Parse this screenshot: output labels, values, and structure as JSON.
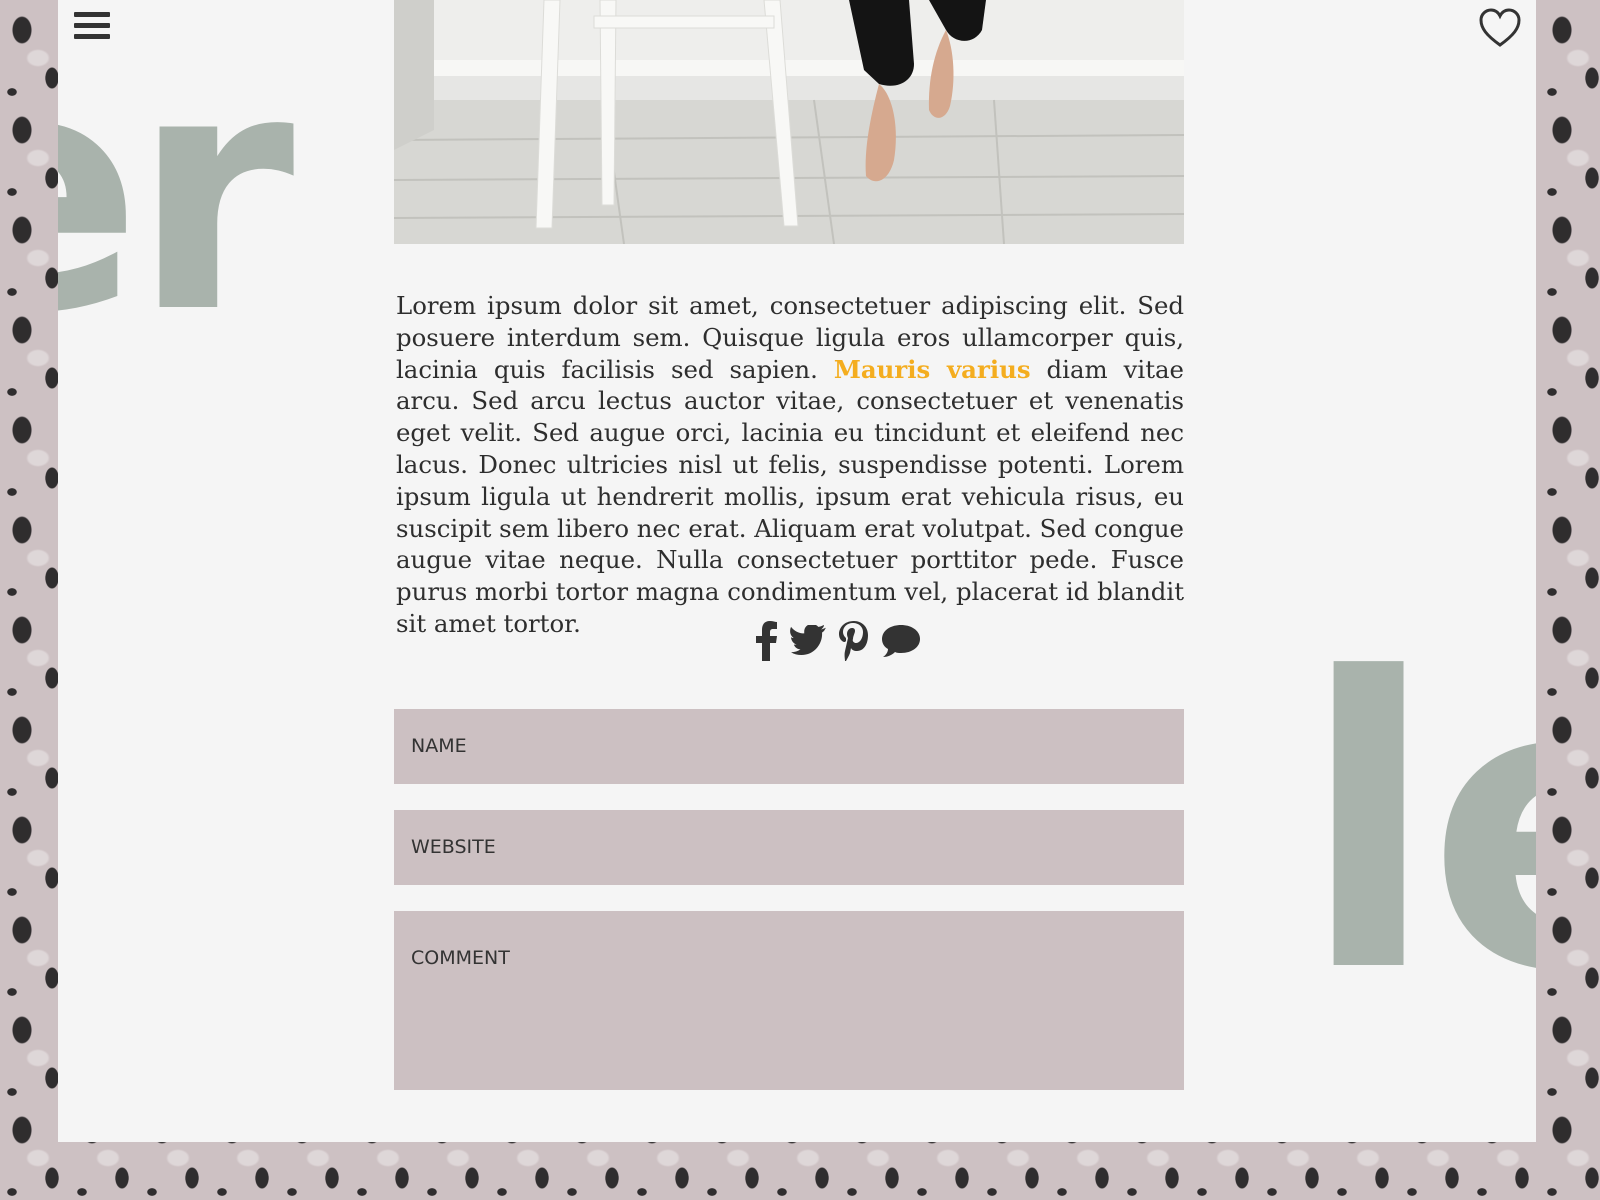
{
  "page": {
    "menu_icon": "hamburger-menu-icon",
    "favorite_icon": "heart-icon",
    "colors": {
      "background": "#cdc1c3",
      "panel": "#f5f5f5",
      "decorative_letters": "#a9b3ac",
      "accent_link": "#f4ad1f",
      "form_field": "#ccc0c2",
      "text": "#2e2e2e"
    }
  },
  "decor": {
    "left_letters": "er",
    "right_letters": "le"
  },
  "article": {
    "image_icon": "photo-stool-bare-feet",
    "text_before_link": "Lorem ipsum dolor sit amet, consectetuer adipiscing elit. Sed posuere interdum sem. Quisque ligula eros ullamcorper quis, lacinia quis facilisis sed sapien. ",
    "link_text": "Mauris varius",
    "text_after_link": " diam vitae arcu. Sed arcu lectus auctor vitae, consectetuer et venenatis eget velit. Sed augue orci, lacinia eu tincidunt et eleifend nec lacus. Donec ultricies nisl ut felis, suspendisse potenti. Lorem ipsum ligula ut hendrerit mollis, ipsum erat vehicula risus, eu suscipit sem libero nec erat. Aliquam erat volutpat. Sed congue augue vitae neque. Nulla consectetuer porttitor pede. Fusce purus morbi tortor magna condimentum vel, placerat id blandit sit amet tortor."
  },
  "share": {
    "icons": [
      "facebook-icon",
      "twitter-icon",
      "pinterest-icon",
      "comment-icon"
    ]
  },
  "form": {
    "name_placeholder": "NAME",
    "website_placeholder": "WEBSITE",
    "comment_placeholder": "COMMENT"
  }
}
